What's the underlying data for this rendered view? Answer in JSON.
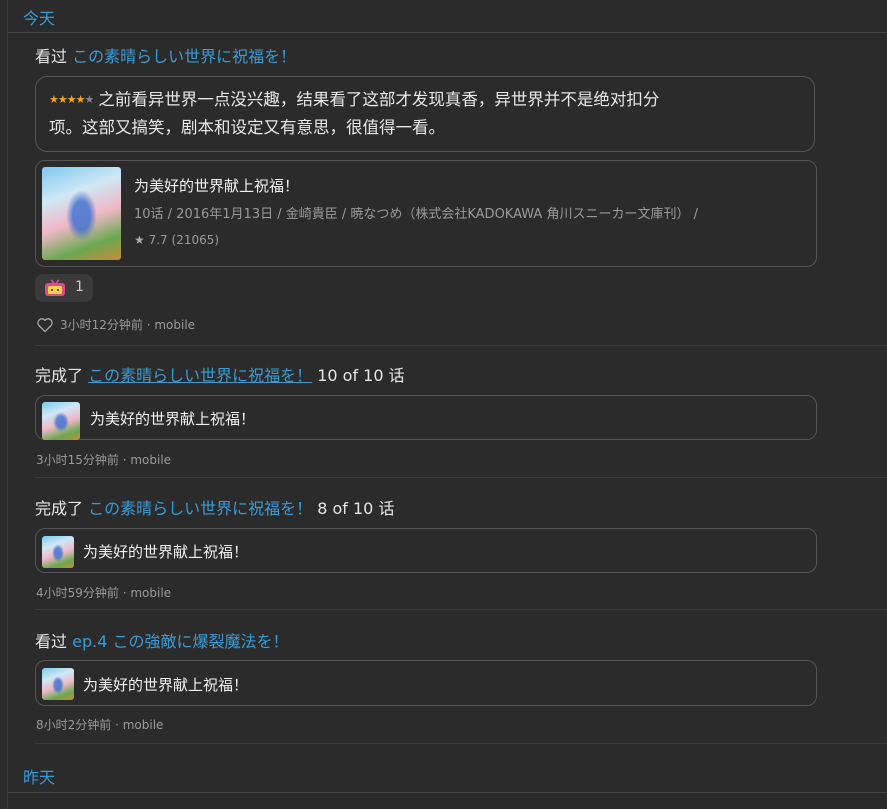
{
  "days": {
    "today": "今天",
    "yesterday": "昨天"
  },
  "entries": [
    {
      "action": "看过",
      "subject_title": "この素晴らしい世界に祝福を！",
      "rating": 4,
      "max_rating": 5,
      "comment": "之前看异世界一点没兴趣，结果看了这部才发现真香，异世界并不是绝对扣分项。这部又搞笑，剧本和设定又有意思，很值得一看。",
      "comment_line1": "之前看异世界一点没兴趣，结果看了这部才发现真香，异世界并不是绝对扣分",
      "comment_line2": "项。这部又搞笑，剧本和设定又有意思，很值得一看。",
      "card": {
        "title": "为美好的世界献上祝福！",
        "info": "10话 / 2016年1月13日 / 金崎貴臣 / 暁なつめ（株式会社KADOKAWA 角川スニーカー文庫刊） /",
        "score": "7.7",
        "votes": "(21065)"
      },
      "reaction": {
        "icon": "tv-icon",
        "count": "1"
      },
      "meta": "3小时12分钟前 · mobile"
    },
    {
      "action": "完成了",
      "subject_title": "この素晴らしい世界に祝福を！",
      "progress": "10 of 10 话",
      "card": {
        "title": "为美好的世界献上祝福！"
      },
      "meta": "3小时15分钟前 · mobile"
    },
    {
      "action": "完成了",
      "subject_title": "この素晴らしい世界に祝福を！",
      "progress": "8 of 10 话",
      "card": {
        "title": "为美好的世界献上祝福！"
      },
      "meta": "4小时59分钟前 · mobile"
    },
    {
      "action": "看过",
      "episode": "ep.4",
      "episode_title": "この強敵に爆裂魔法を！",
      "card": {
        "title": "为美好的世界献上祝福！"
      },
      "meta": "8小时2分钟前 · mobile"
    }
  ],
  "colors": {
    "background": "#2b2b2b",
    "link": "#3a9bd5",
    "star": "#f5a623",
    "muted": "#9a9a9a"
  }
}
